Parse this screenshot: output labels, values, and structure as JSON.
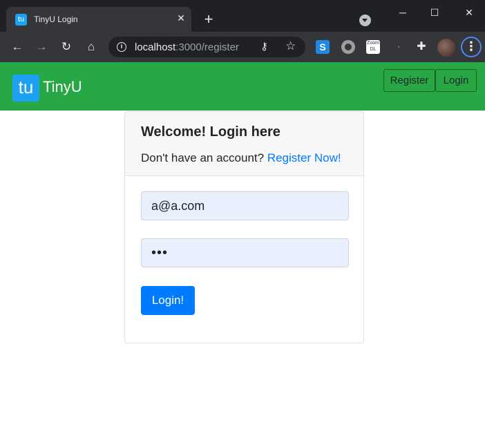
{
  "browser": {
    "tab_title": "TinyU Login",
    "tab_favicon_text": "tu",
    "tab_close": "✕",
    "new_tab": "+",
    "window_controls": {
      "minimize": "─",
      "maximize": "☐",
      "close": "✕"
    },
    "url_host": "localhost",
    "url_path": ":3000/register",
    "nav_icons": {
      "back": "←",
      "forward": "→",
      "reload": "↻",
      "home": "⌂"
    },
    "extensions": {
      "s_label": "S",
      "zoom_label": "Zoom DL"
    },
    "menu": "⋮"
  },
  "navbar": {
    "logo_text": "tu",
    "brand": "TinyU",
    "register_label": "Register",
    "login_label": "Login",
    "color": "#28a745"
  },
  "login_card": {
    "title": "Welcome! Login here",
    "prompt": "Don't have an account?",
    "register_link": "Register Now!",
    "email_value": "a@a.com",
    "password_value": "abc",
    "submit_label": "Login!"
  },
  "colors": {
    "accent": "#007bff",
    "logo": "#1da1f2"
  }
}
